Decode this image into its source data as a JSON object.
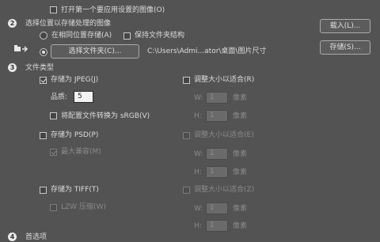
{
  "top": {
    "open_first_label": "打开第一个要应用设置的图像(O)",
    "open_first_checked": false
  },
  "step2": {
    "number": "2",
    "heading": "选择位置以存储处理的图像",
    "same_location_label": "在相同位置存储(A)",
    "keep_structure_label": "保持文件夹结构",
    "choose_folder_button": "选择文件夹(C)...",
    "folder_path": "C:\\Users\\Admi...ator\\桌面\\图片尺寸"
  },
  "step3": {
    "number": "3",
    "heading": "文件类型",
    "jpeg": {
      "save_label": "存储为 JPEG(J)",
      "save_checked": true,
      "quality_label": "品质:",
      "quality_value": "5",
      "convert_label": "将配置文件转换为 sRGB(V)",
      "convert_checked": false,
      "resize_label": "调整大小以适合(R)",
      "resize_checked": false,
      "w_label": "W:",
      "w_value": "1",
      "h_label": "H:",
      "h_value": "1",
      "unit": "像素"
    },
    "psd": {
      "save_label": "存储为 PSD(P)",
      "save_checked": false,
      "compat_label": "最大兼容(M)",
      "compat_checked": true,
      "resize_label": "调整大小以适合(E)",
      "resize_checked": false,
      "w_label": "W:",
      "w_value": "1",
      "h_label": "H:",
      "h_value": "1",
      "unit": "像素"
    },
    "tiff": {
      "save_label": "存储为 TIFF(T)",
      "save_checked": false,
      "lzw_label": "LZW 压缩(W)",
      "lzw_checked": false,
      "resize_label": "调整大小以适合(Z)",
      "resize_checked": false,
      "w_label": "W:",
      "w_value": "1",
      "h_label": "H:",
      "h_value": "1",
      "unit": "像素"
    }
  },
  "step4": {
    "number": "4",
    "heading": "首选项"
  },
  "side": {
    "load_button": "载入(L)...",
    "save_button": "存储(S)..."
  },
  "icons": {
    "folder_arrow": "folder-arrow-icon"
  }
}
